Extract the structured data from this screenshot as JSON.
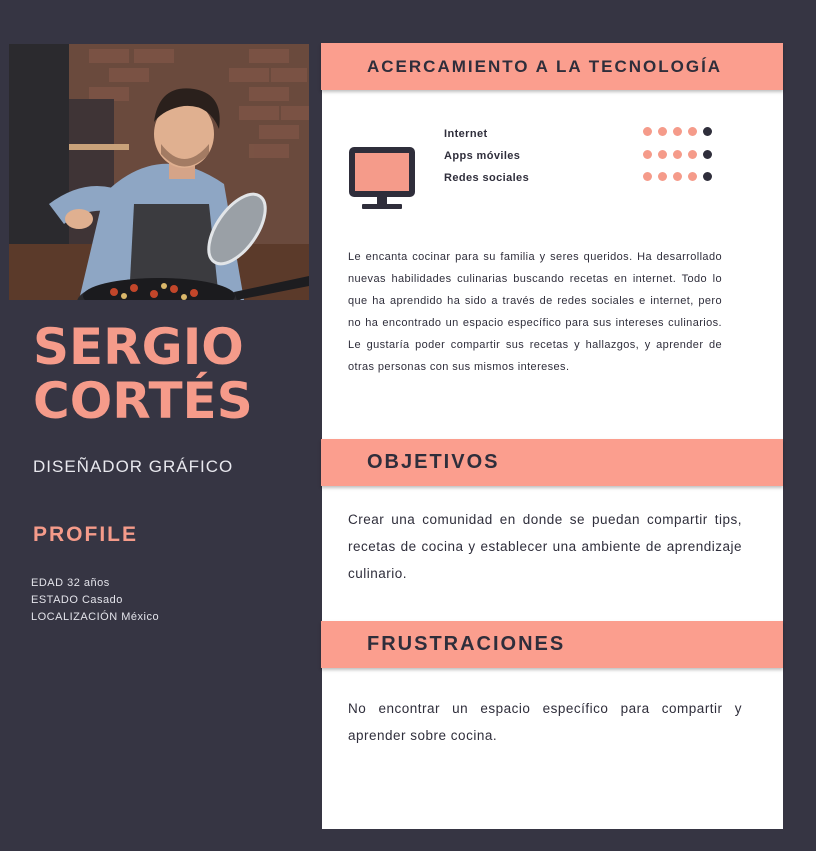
{
  "person": {
    "first_name": "SERGIO",
    "last_name": "CORTÉS",
    "role": "DISEÑADOR GRÁFICO"
  },
  "profile": {
    "title": "PROFILE",
    "items": [
      "EDAD 32 años",
      "ESTADO Casado",
      "LOCALIZACIÓN México"
    ]
  },
  "tech": {
    "title": "ACERCAMIENTO A LA TECNOLOGÍA",
    "icon": "monitor-icon",
    "skills": [
      {
        "label": "Internet",
        "level": 4,
        "max": 5
      },
      {
        "label": "Apps móviles",
        "level": 4,
        "max": 5
      },
      {
        "label": "Redes sociales",
        "level": 4,
        "max": 5
      }
    ],
    "bio": "Le encanta cocinar para su familia y seres queridos. Ha desarrollado nuevas habilidades culinarias buscando recetas en internet.  Todo lo que ha aprendido ha sido a través de redes sociales e internet, pero no ha encontrado un espacio específico para sus intereses culinarios. Le gustaría poder compartir sus recetas y hallazgos, y aprender de otras personas con sus mismos intereses."
  },
  "objectives": {
    "title": "OBJETIVOS",
    "text": "Crear una comunidad en donde se puedan compartir tips, recetas de cocina y establecer una ambiente de aprendizaje culinario."
  },
  "frustrations": {
    "title": "FRUSTRACIONES",
    "text": "No encontrar un espacio específico para compartir y aprender sobre cocina."
  },
  "colors": {
    "background": "#363543",
    "accent": "#f59b8a",
    "banner": "#fb9e8e",
    "text_dark": "#2f2e3b",
    "panel": "#ffffff"
  }
}
